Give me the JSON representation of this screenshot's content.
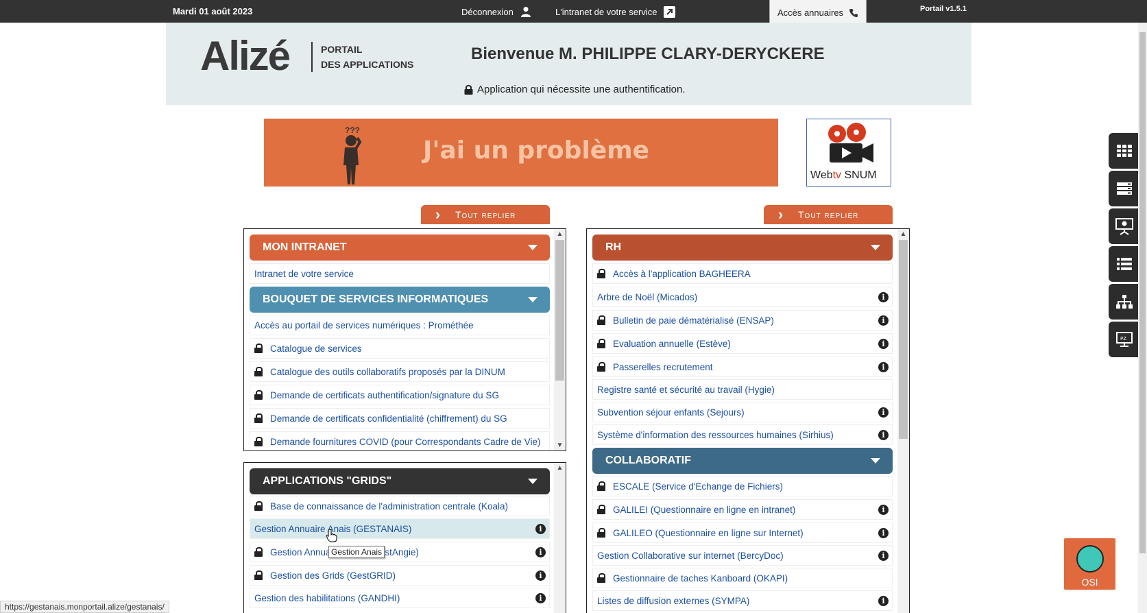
{
  "topbar": {
    "date": "Mardi 01 août 2023",
    "logout": "Déconnexion",
    "intranet": "L'intranet de votre service",
    "annuaires": "Accès annuaires",
    "version": "Portail v1.5.1"
  },
  "header": {
    "logo": "Alizé",
    "logo_sub1": "PORTAIL",
    "logo_sub2": "DES APPLICATIONS",
    "welcome": "Bienvenue M. PHILIPPE CLARY-DERYCKERE",
    "auth_note": "Application qui nécessite une authentification."
  },
  "banner": {
    "probleme": "J'ai un problème",
    "question_marks": "???",
    "webtv_a": "Web",
    "webtv_b": "tv",
    "webtv_c": " SNUM"
  },
  "replier_label": "Tout replier",
  "left_top": {
    "cat1": "MON INTRANET",
    "cat2": "BOUQUET DE SERVICES INFORMATIQUES",
    "items": [
      "Intranet de votre service",
      "Accès au portail de services numériques : Prométhée",
      "Catalogue de services",
      "Catalogue des outils collaboratifs proposés par la DINUM",
      "Demande de certificats authentification/signature du SG",
      "Demande de certificats confidentialité (chiffrement) du SG",
      "Demande fournitures COVID (pour Correspondants Cadre de Vie)"
    ]
  },
  "left_bottom": {
    "cat": "APPLICATIONS \"GRIDS\"",
    "items": [
      "Base de connaissance de l'administration centrale (Koala)",
      "Gestion Annuaire Anais (GESTANAIS)",
      "Gestion Annuaire Angie (GestAngie)",
      "Gestion des Grids (GestGRID)",
      "Gestion des habilitations (GANDHI)"
    ]
  },
  "right": {
    "cat1": "RH",
    "cat2": "COLLABORATIF",
    "items": [
      "Accès à l'application BAGHEERA",
      "Arbre de Noël (Micados)",
      "Bulletin de paie dématérialisé (ENSAP)",
      "Evaluation annuelle (Estève)",
      "Passerelles recrutement",
      "Registre santé et sécurité au travail (Hygie)",
      "Subvention séjour enfants (Sejours)",
      "Système d'information des ressources humaines (Sirhius)",
      "ESCALE (Service d'Echange de Fichiers)",
      "GALILEI (Questionnaire en ligne en intranet)",
      "GALILEO (Questionnaire en ligne sur Internet)",
      "Gestion Collaborative sur internet (BercyDoc)",
      "Gestionnaire de taches Kanboard (OKAPI)",
      "Listes de diffusion externes (SYMPA)"
    ]
  },
  "info_glyph": "i",
  "osi_label": "OSI",
  "tooltip": "Gestion Anais",
  "status_url": "https://gestanais.monportail.alize/gestanais/",
  "colors": {
    "topbar": "#333333",
    "orange": "#d8633a",
    "blue": "#4f8fb0",
    "rh": "#b9502f",
    "collab": "#3d6a86",
    "grids": "#333333"
  }
}
